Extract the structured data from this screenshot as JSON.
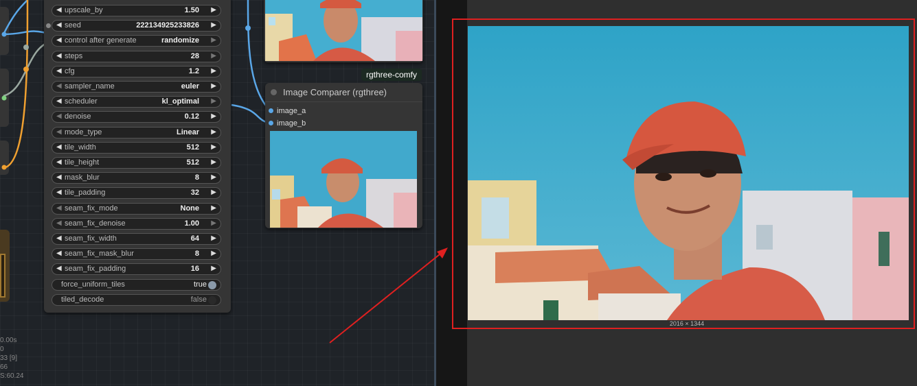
{
  "app": {
    "sidebar_status": [
      "0.00s",
      "0",
      "33 [9]",
      "66",
      "S:60.24"
    ]
  },
  "upscale_node": {
    "widgets": [
      {
        "label": "upscale_by",
        "value": "1.50"
      },
      {
        "label": "seed",
        "value": "222134925233826"
      },
      {
        "label": "control after generate",
        "value": "randomize"
      },
      {
        "label": "steps",
        "value": "28"
      },
      {
        "label": "cfg",
        "value": "1.2"
      },
      {
        "label": "sampler_name",
        "value": "euler"
      },
      {
        "label": "scheduler",
        "value": "kl_optimal"
      },
      {
        "label": "denoise",
        "value": "0.12"
      },
      {
        "label": "mode_type",
        "value": "Linear"
      },
      {
        "label": "tile_width",
        "value": "512"
      },
      {
        "label": "tile_height",
        "value": "512"
      },
      {
        "label": "mask_blur",
        "value": "8"
      },
      {
        "label": "tile_padding",
        "value": "32"
      },
      {
        "label": "seam_fix_mode",
        "value": "None"
      },
      {
        "label": "seam_fix_denoise",
        "value": "1.00"
      },
      {
        "label": "seam_fix_width",
        "value": "64"
      },
      {
        "label": "seam_fix_mask_blur",
        "value": "8"
      },
      {
        "label": "seam_fix_padding",
        "value": "16"
      }
    ],
    "toggles": [
      {
        "label": "force_uniform_tiles",
        "value": "true"
      },
      {
        "label": "tiled_decode",
        "value": "false"
      }
    ]
  },
  "comparer_node": {
    "group_tag": "rgthree-comfy",
    "title": "Image Comparer (rgthree)",
    "inputs": [
      "image_a",
      "image_b"
    ]
  },
  "preview": {
    "dimensions": "2016 × 1344"
  },
  "colors": {
    "link_blue": "#5aa7e8",
    "link_orange": "#f0a030",
    "link_green": "#7fd07f",
    "highlight_red": "#e02020"
  }
}
